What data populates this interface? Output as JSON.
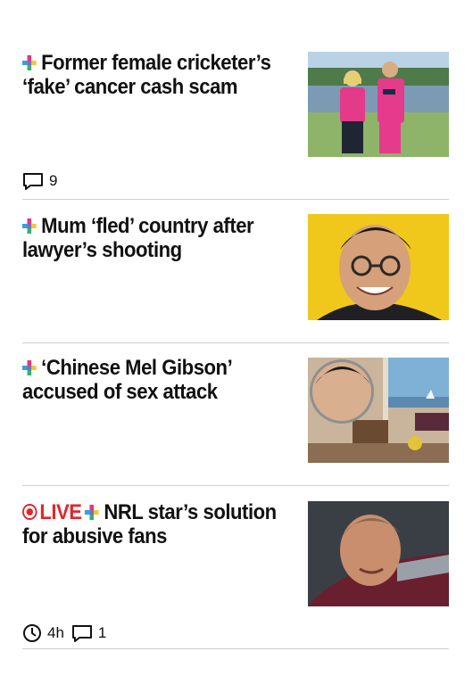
{
  "stories": [
    {
      "headline": "Former female cricketer’s ‘fake’ cancer cash scam",
      "premium": true,
      "comments": "9",
      "image": "two players in pink cricket uniforms by a lake"
    },
    {
      "headline": "Mum ‘fled’ country after lawyer’s shooting",
      "premium": true,
      "image": "smiling man in glasses on yellow background"
    },
    {
      "headline": "‘Chinese Mel Gibson’ accused of sex attack",
      "premium": true,
      "image": "inset portrait over harbour-view hotel room"
    },
    {
      "live_label": "LIVE",
      "headline": "NRL star’s solution for abusive fans",
      "premium": true,
      "time": "4h",
      "comments": "1",
      "image": "rugby league player in maroon jersey"
    }
  ],
  "colors": {
    "live": "#e3262b",
    "divider": "#cfcfcf",
    "plus_pink": "#e8357c",
    "plus_blue": "#35a0e3",
    "plus_yellow": "#f7c531",
    "plus_green": "#2fb36a"
  },
  "icons": {
    "premium": "plus-icon",
    "comments": "comment-icon",
    "time": "clock-icon",
    "live": "live-dot-icon"
  }
}
